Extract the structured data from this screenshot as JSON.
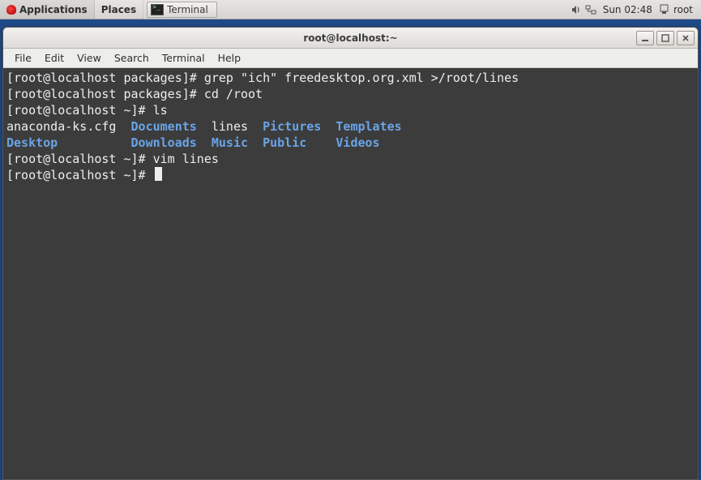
{
  "panel": {
    "applications": "Applications",
    "places": "Places",
    "task_terminal": "Terminal",
    "clock": "Sun 02:48",
    "user": "root"
  },
  "window": {
    "title": "root@localhost:~",
    "menus": {
      "file": "File",
      "edit": "Edit",
      "view": "View",
      "search": "Search",
      "terminal": "Terminal",
      "help": "Help"
    }
  },
  "term": {
    "l1_prompt": "[root@localhost packages]# ",
    "l1_cmd": "grep \"ich\" freedesktop.org.xml >/root/lines",
    "l2_prompt": "[root@localhost packages]# ",
    "l2_cmd": "cd /root",
    "l3_prompt": "[root@localhost ~]# ",
    "l3_cmd": "ls",
    "ls_plain_1": "anaconda-ks.cfg  ",
    "ls_documents": "Documents",
    "ls_gap1": "  ",
    "ls_plain_2": "lines  ",
    "ls_pictures": "Pictures",
    "ls_gap2": "  ",
    "ls_templates": "Templates",
    "ls_desktop": "Desktop",
    "ls_pad1": "          ",
    "ls_downloads": "Downloads",
    "ls_gap3": "  ",
    "ls_music": "Music",
    "ls_gap4": "  ",
    "ls_public": "Public",
    "ls_gap5": "    ",
    "ls_videos": "Videos",
    "l6_prompt": "[root@localhost ~]# ",
    "l6_cmd": "vim lines",
    "l7_prompt": "[root@localhost ~]# "
  }
}
